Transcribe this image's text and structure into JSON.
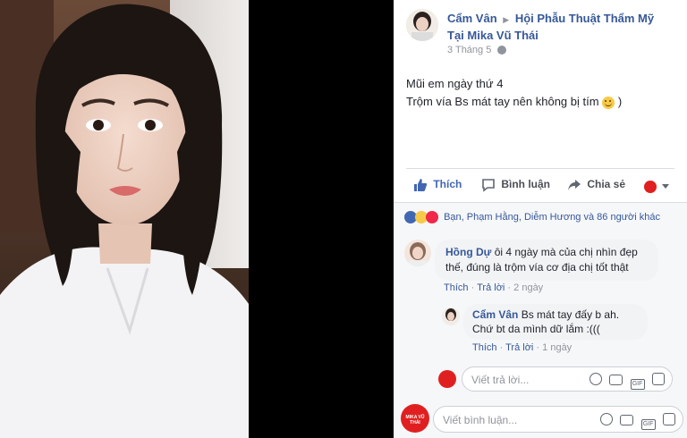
{
  "post": {
    "author": "Cẩm Vân",
    "arrow": "▶",
    "page_name_line1": "Hội Phẫu Thuật Thẩm Mỹ",
    "page_name_line2": "Tại Mika Vũ Thái",
    "date": "3 Tháng 5",
    "text_line1": "Mũi em ngày thứ 4",
    "text_line2": "Trộm vía Bs mát tay nên không bị tím",
    "text_line2_end": ")"
  },
  "actions": {
    "like": "Thích",
    "comment": "Bình luận",
    "share": "Chia sẻ"
  },
  "reactions": {
    "summary": "Bạn, Phạm Hằng, Diễm Hương và 86 người khác"
  },
  "comments": [
    {
      "author": "Hồng Dự",
      "text_line1": "ôi 4 ngày mà của chị nhìn đẹp",
      "text_line2": "thế, đúng là trộm vía cơ địa chị tốt thật",
      "like": "Thích",
      "reply": "Trả lời",
      "time": "2 ngày"
    },
    {
      "author": "Cẩm Vân",
      "text_line1": "Bs mát tay đấy b ah.",
      "text_line2": "Chứ bt da mình dữ lắm :(((",
      "like": "Thích",
      "reply": "Trả lời",
      "time": "1 ngày"
    }
  ],
  "reply_input": {
    "placeholder": "Viết trả lời..."
  },
  "comment_input": {
    "placeholder": "Viết bình luận..."
  },
  "mika_logo_text": "MIKA VŨ THÁI",
  "colors": {
    "link": "#365899",
    "like_blue": "#4267b2",
    "brand_red": "#e02020"
  }
}
